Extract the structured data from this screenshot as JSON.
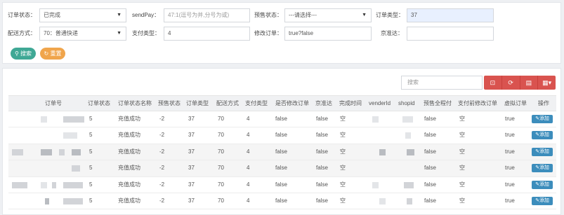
{
  "filters": {
    "order_status_label": "订单状态：",
    "order_status_value": "已完成",
    "sendpay_label": "sendPay：",
    "sendpay_placeholder": "47:1(逗号为并,分号为或)",
    "presale_status_label": "预售状态：",
    "presale_status_value": "---请选择---",
    "order_type_label": "订单类型：",
    "order_type_value": "37",
    "delivery_label": "配送方式：",
    "delivery_value": "70：普通快递",
    "pay_type_label": "支付类型：",
    "pay_type_value": "4",
    "modify_order_label": "修改订单：",
    "modify_order_value": "true?false",
    "jingzhunda_label": "京准达：",
    "jingzhunda_value": "",
    "search_button": "搜索",
    "reset_button": "重置"
  },
  "toolbar": {
    "search_placeholder": "搜索",
    "icons": [
      "export-icon",
      "refresh-icon",
      "toggle-view-icon",
      "columns-icon"
    ]
  },
  "table": {
    "headers": [
      "订单号",
      "订单状态",
      "订单状态名称",
      "预售状态",
      "订单类型",
      "配送方式",
      "支付类型",
      "是否修改订单",
      "京准达",
      "完成时间",
      "venderId",
      "shopid",
      "预售全程付",
      "支付前修改订单",
      "虚拟订单",
      "操作"
    ],
    "rows": [
      {
        "status": "5",
        "status_name": "充值成功",
        "presale": "-2",
        "type": "37",
        "delivery": "70",
        "pay": "4",
        "modified": "false",
        "jzd": "false",
        "finish": "空",
        "full_pay": "false",
        "pre_modify": "空",
        "virtual": "true",
        "action": "添加"
      },
      {
        "status": "5",
        "status_name": "充值成功",
        "presale": "-2",
        "type": "37",
        "delivery": "70",
        "pay": "4",
        "modified": "false",
        "jzd": "false",
        "finish": "空",
        "full_pay": "false",
        "pre_modify": "空",
        "virtual": "true",
        "action": "添加"
      },
      {
        "status": "5",
        "status_name": "充值成功",
        "presale": "-2",
        "type": "37",
        "delivery": "70",
        "pay": "4",
        "modified": "false",
        "jzd": "false",
        "finish": "空",
        "full_pay": "false",
        "pre_modify": "空",
        "virtual": "true",
        "action": "添加"
      },
      {
        "status": "5",
        "status_name": "充值成功",
        "presale": "-2",
        "type": "37",
        "delivery": "70",
        "pay": "4",
        "modified": "false",
        "jzd": "false",
        "finish": "空",
        "full_pay": "false",
        "pre_modify": "空",
        "virtual": "true",
        "action": "添加"
      },
      {
        "status": "5",
        "status_name": "充值成功",
        "presale": "-2",
        "type": "37",
        "delivery": "70",
        "pay": "4",
        "modified": "false",
        "jzd": "false",
        "finish": "空",
        "full_pay": "false",
        "pre_modify": "空",
        "virtual": "true",
        "action": "添加"
      },
      {
        "status": "5",
        "status_name": "充值成功",
        "presale": "-2",
        "type": "37",
        "delivery": "70",
        "pay": "4",
        "modified": "false",
        "jzd": "false",
        "finish": "空",
        "full_pay": "false",
        "pre_modify": "空",
        "virtual": "true",
        "action": "添加"
      }
    ]
  }
}
